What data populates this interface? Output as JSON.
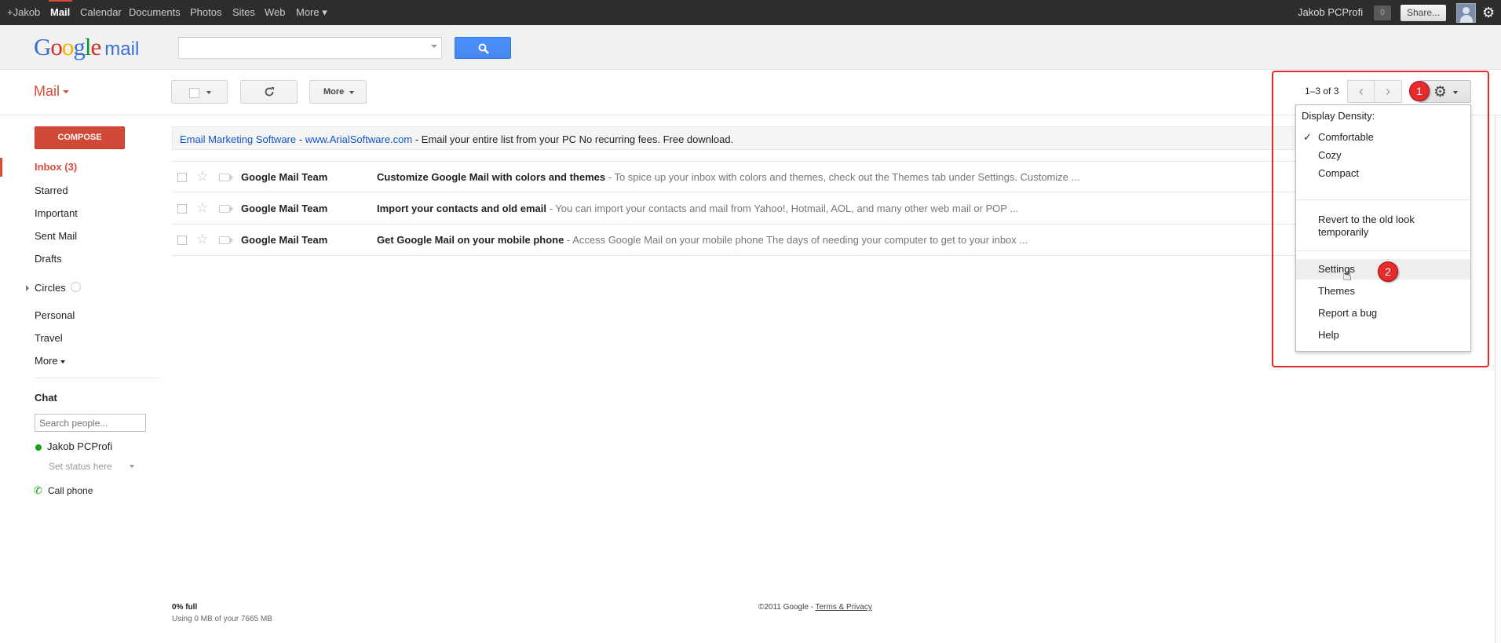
{
  "topbar": {
    "items": [
      "+Jakob",
      "Mail",
      "Calendar",
      "Documents",
      "Photos",
      "Sites",
      "Web",
      "More ▾"
    ],
    "active": "Mail",
    "user": "Jakob PCProfi",
    "notifications": "0",
    "share": "Share..."
  },
  "header": {
    "logo_google": "Google",
    "logo_mail": "mail",
    "search_placeholder": ""
  },
  "toolbar": {
    "mail_label": "Mail",
    "more_label": "More",
    "pager": "1–3 of 3"
  },
  "sidebar": {
    "compose": "COMPOSE",
    "items": [
      "Inbox (3)",
      "Starred",
      "Important",
      "Sent Mail",
      "Drafts",
      "Circles",
      "Personal",
      "Travel",
      "More"
    ],
    "selected": "Inbox (3)",
    "chat": {
      "title": "Chat",
      "search_placeholder": "Search people...",
      "user": "Jakob PCProfi",
      "status": "Set status here",
      "call_phone": "Call phone"
    }
  },
  "ad": {
    "title": "Email Marketing Software",
    "url": "www.ArialSoftware.com",
    "text": "Email your entire list from your PC No recurring fees. Free download."
  },
  "messages": [
    {
      "sender": "Google Mail Team",
      "subject": "Customize Google Mail with colors and themes",
      "snippet": "To spice up your inbox with colors and themes, check out the Themes tab under Settings. Customize ..."
    },
    {
      "sender": "Google Mail Team",
      "subject": "Import your contacts and old email",
      "snippet": "You can import your contacts and mail from Yahoo!, Hotmail, AOL, and many other web mail or POP ..."
    },
    {
      "sender": "Google Mail Team",
      "subject": "Get Google Mail on your mobile phone",
      "snippet": "Access Google Mail on your mobile phone The days of needing your computer to get to your inbox ..."
    }
  ],
  "footer": {
    "quota": "0% full",
    "quota_detail": "Using 0 MB of your 7665 MB",
    "copyright": "©2011 Google - ",
    "terms": "Terms & Privacy"
  },
  "settings_menu": {
    "header": "Display Density:",
    "density": [
      "Comfortable",
      "Cozy",
      "Compact"
    ],
    "checked": "Comfortable",
    "revert": "Revert to the old look temporarily",
    "items": [
      "Settings",
      "Themes",
      "Report a bug",
      "Help"
    ],
    "highlighted": "Settings"
  },
  "annotations": {
    "badge1": "1",
    "badge2": "2",
    "color": "#e52b2b"
  }
}
